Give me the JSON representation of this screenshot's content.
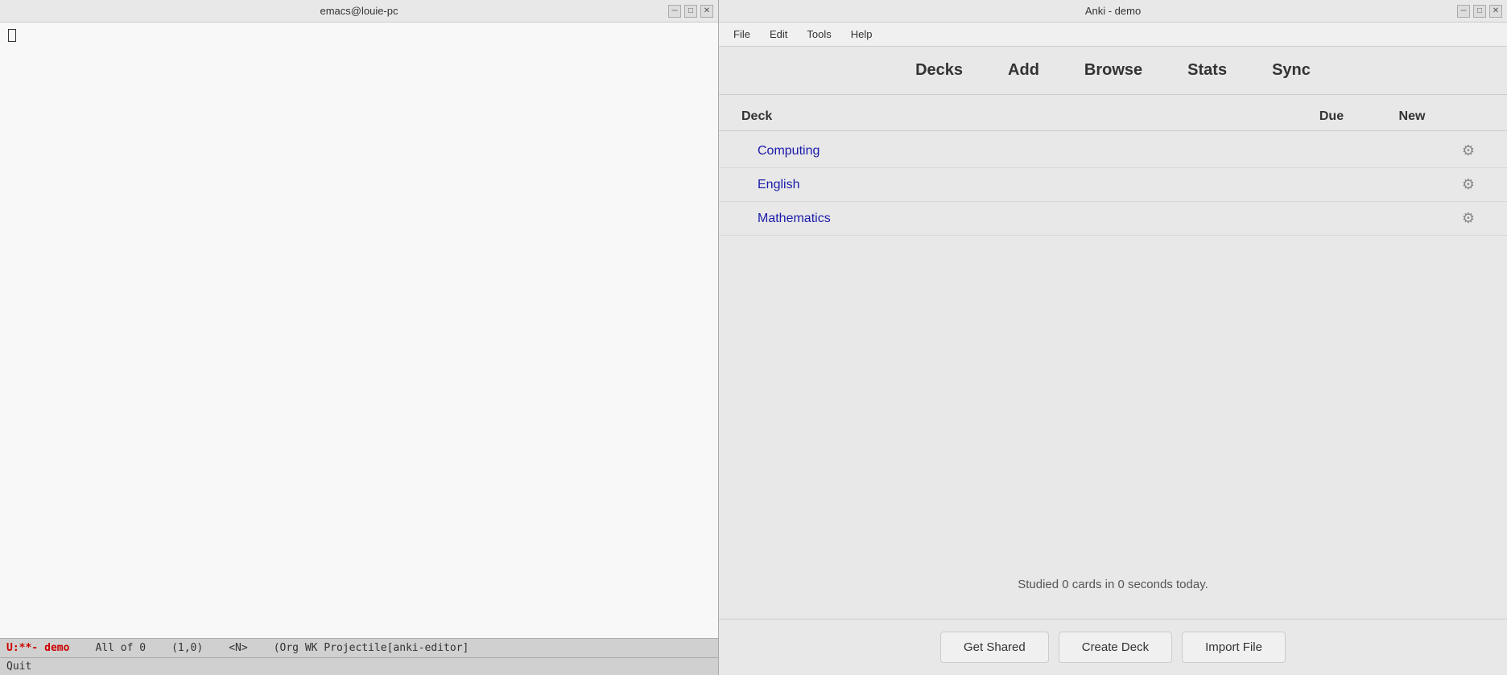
{
  "emacs": {
    "titlebar": "emacs@louie-pc",
    "statusbar": {
      "mode": "U:**-",
      "buffer": "demo",
      "position": "All of 0",
      "coords": "(1,0)",
      "extra": "<N>",
      "mode_line": "(Org WK Projectile[anki-editor]"
    },
    "minibuffer": "Quit",
    "win_controls": {
      "minimize": "─",
      "maximize": "□",
      "close": "✕"
    }
  },
  "anki": {
    "titlebar": "Anki - demo",
    "win_controls": {
      "minimize": "─",
      "maximize": "□",
      "close": "✕"
    },
    "menu": {
      "items": [
        "File",
        "Edit",
        "Tools",
        "Help"
      ]
    },
    "toolbar": {
      "buttons": [
        "Decks",
        "Add",
        "Browse",
        "Stats",
        "Sync"
      ]
    },
    "decks_header": {
      "deck_col": "Deck",
      "due_col": "Due",
      "new_col": "New"
    },
    "decks": [
      {
        "name": "Computing",
        "due": "",
        "new": ""
      },
      {
        "name": "English",
        "due": "",
        "new": ""
      },
      {
        "name": "Mathematics",
        "due": "",
        "new": ""
      }
    ],
    "studied_text": "Studied 0 cards in 0 seconds today.",
    "footer_buttons": {
      "get_shared": "Get Shared",
      "create_deck": "Create Deck",
      "import_file": "Import File"
    }
  }
}
